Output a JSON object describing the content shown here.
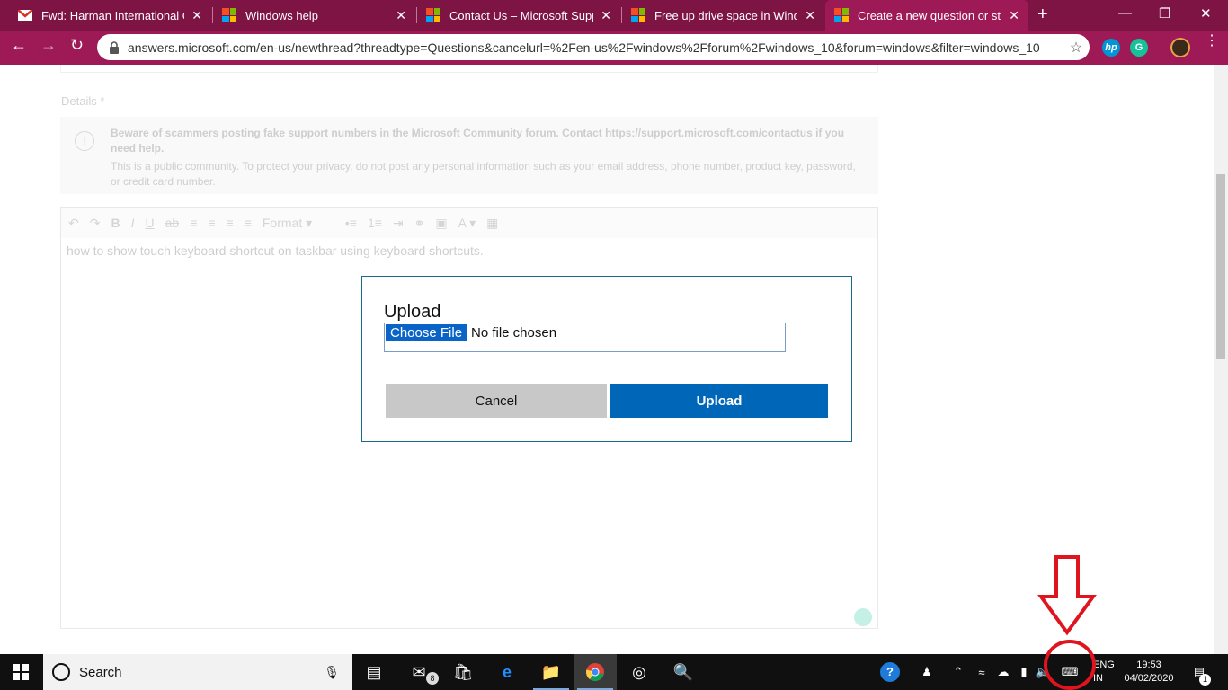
{
  "browser": {
    "tabs": [
      {
        "title": "Fwd: Harman International Cas",
        "icon": "gmail-icon",
        "active": false
      },
      {
        "title": "Windows help",
        "icon": "microsoft-icon",
        "active": false
      },
      {
        "title": "Contact Us – Microsoft Suppor",
        "icon": "microsoft-icon",
        "active": false
      },
      {
        "title": "Free up drive space in Window",
        "icon": "microsoft-icon",
        "active": false
      },
      {
        "title": "Create a new question or start",
        "icon": "microsoft-icon",
        "active": true
      }
    ],
    "close_glyph": "✕",
    "new_tab_glyph": "+",
    "url": "answers.microsoft.com/en-us/newthread?threadtype=Questions&cancelurl=%2Fen-us%2Fwindows%2Fforum%2Fwindows_10&forum=windows&filter=windows_10",
    "accent": "#9e1a57",
    "tabstrip_color": "#7d1443",
    "extensions": [
      {
        "name": "hp-extension-icon",
        "label": "hp"
      },
      {
        "name": "grammarly-extension-icon",
        "label": "G"
      }
    ]
  },
  "page": {
    "details_label": "Details *",
    "notice_bold": "Beware of scammers posting fake support numbers in the Microsoft Community forum. Contact https://support.microsoft.com/contactus if you need help.",
    "notice_text": "This is a public community. To protect your privacy, do not post any personal information such as your email address, phone number, product key, password, or credit card number.",
    "format_label": "Format",
    "editor_text": "how to show touch keyboard shortcut on taskbar using keyboard shortcuts."
  },
  "modal": {
    "title": "Upload",
    "choose_file_label": "Choose File",
    "no_file_text": "No file chosen",
    "cancel_label": "Cancel",
    "upload_label": "Upload",
    "upload_color": "#0067b8"
  },
  "taskbar": {
    "search_label": "Search",
    "mail_badge": "8",
    "lang_line1": "ENG",
    "lang_line2": "IN",
    "time": "19:53",
    "date": "04/02/2020",
    "notification_badge": "1"
  },
  "annotation_color": "#e0141e"
}
